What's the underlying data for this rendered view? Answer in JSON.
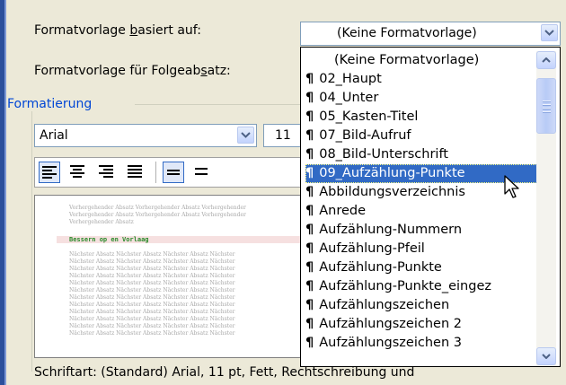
{
  "labels": {
    "based_on_prefix": "Formatvorlage ",
    "based_on_underlined": "b",
    "based_on_suffix": "asiert auf:",
    "next_prefix": "Formatvorlage für Folgeab",
    "next_underlined": "s",
    "next_suffix": "atz:",
    "formatting_group": "Formatierung"
  },
  "based_on_combo": {
    "value": "(Keine Formatvorlage)"
  },
  "font_combo": {
    "value": "Arial"
  },
  "size_combo": {
    "value": "11"
  },
  "toolbar": {
    "buttons": [
      "align-left",
      "align-center",
      "align-right",
      "justify",
      "line-spacing-single",
      "line-spacing-1_5"
    ]
  },
  "preview": {
    "prev_para_1": "Vorhergehender Absatz Vorhergehender Absatz Vorhergehender",
    "prev_para_2": "Vorhergehender Absatz Vorhergehender Absatz Vorhergehender",
    "prev_para_3": "Vorhergehender Absatz",
    "sample": "Bessern op en Vorlaag",
    "next_para": "Nächster Absatz Nächster Absatz Nächster Absatz Nächster"
  },
  "description": "Schriftart: (Standard) Arial, 11 pt, Fett, Rechtschreibung und",
  "dropdown": {
    "items": [
      {
        "pilcrow": "",
        "label": "(Keine Formatvorlage)"
      },
      {
        "pilcrow": "¶",
        "label": "02_Haupt"
      },
      {
        "pilcrow": "¶",
        "label": "04_Unter"
      },
      {
        "pilcrow": "¶",
        "label": "05_Kasten-Titel"
      },
      {
        "pilcrow": "¶",
        "label": "07_Bild-Aufruf"
      },
      {
        "pilcrow": "¶",
        "label": "08_Bild-Unterschrift"
      },
      {
        "pilcrow": "¶",
        "label": "09_Aufzählung-Punkte"
      },
      {
        "pilcrow": "¶",
        "label": "Abbildungsverzeichnis"
      },
      {
        "pilcrow": "¶",
        "label": "Anrede"
      },
      {
        "pilcrow": "¶",
        "label": "Aufzählung-Nummern"
      },
      {
        "pilcrow": "¶",
        "label": "Aufzählung-Pfeil"
      },
      {
        "pilcrow": "¶",
        "label": "Aufzählung-Punkte"
      },
      {
        "pilcrow": "¶",
        "label": "Aufzählung-Punkte_eingez"
      },
      {
        "pilcrow": "¶",
        "label": "Aufzählungszeichen"
      },
      {
        "pilcrow": "¶",
        "label": "Aufzählungszeichen 2"
      },
      {
        "pilcrow": "¶",
        "label": "Aufzählungszeichen 3"
      }
    ],
    "selected_index": 6
  },
  "colors": {
    "selection": "#316ac5",
    "accent_border": "#7f9db9",
    "window_edge": "#2b4f9c"
  }
}
